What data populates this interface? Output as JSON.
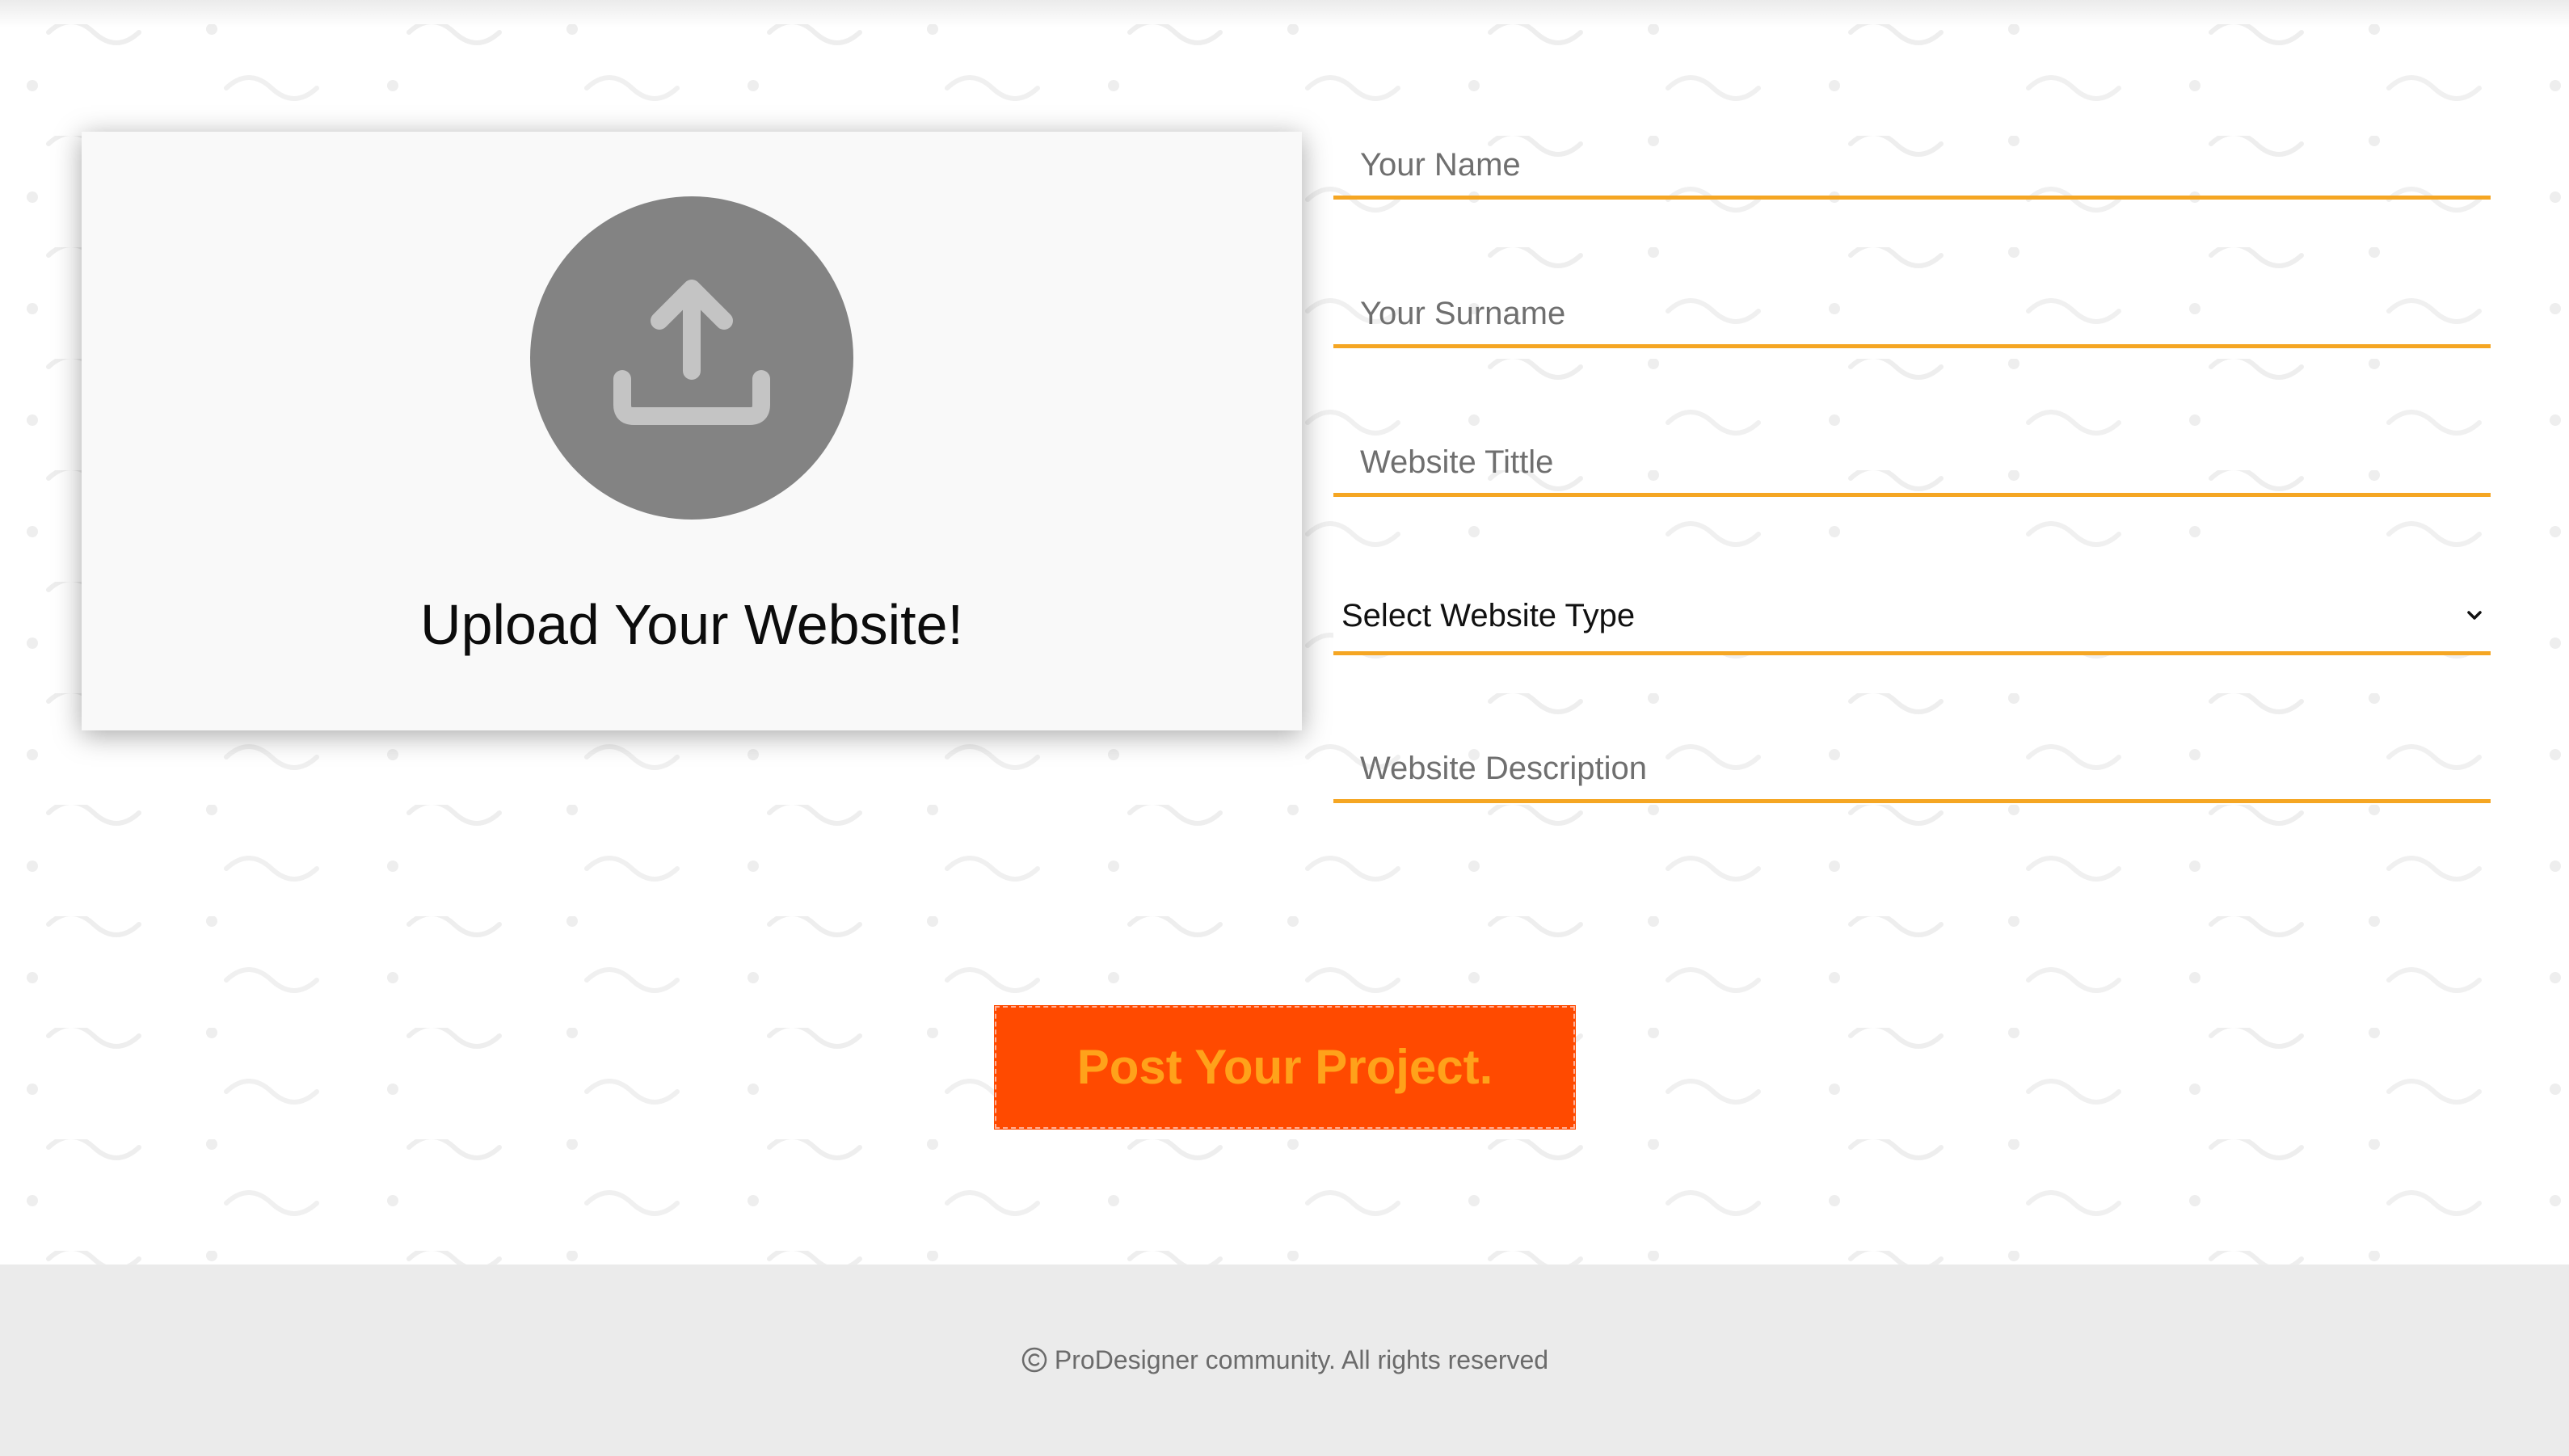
{
  "upload": {
    "label": "Upload Your Website!",
    "icon": "upload-icon"
  },
  "form": {
    "name_placeholder": "Your Name",
    "surname_placeholder": "Your Surname",
    "title_placeholder": "Website Tittle",
    "type_select_label": "Select Website Type",
    "description_placeholder": "Website Description"
  },
  "submit": {
    "label": "Post Your Project."
  },
  "footer": {
    "text": "ProDesigner community. All rights reserved",
    "icon": "copyright-icon"
  },
  "colors": {
    "accent_underline": "#f5a623",
    "button_bg": "#ff4a00",
    "button_text": "#ffa21a",
    "footer_bg": "#ebebeb",
    "upload_circle": "#838383"
  }
}
